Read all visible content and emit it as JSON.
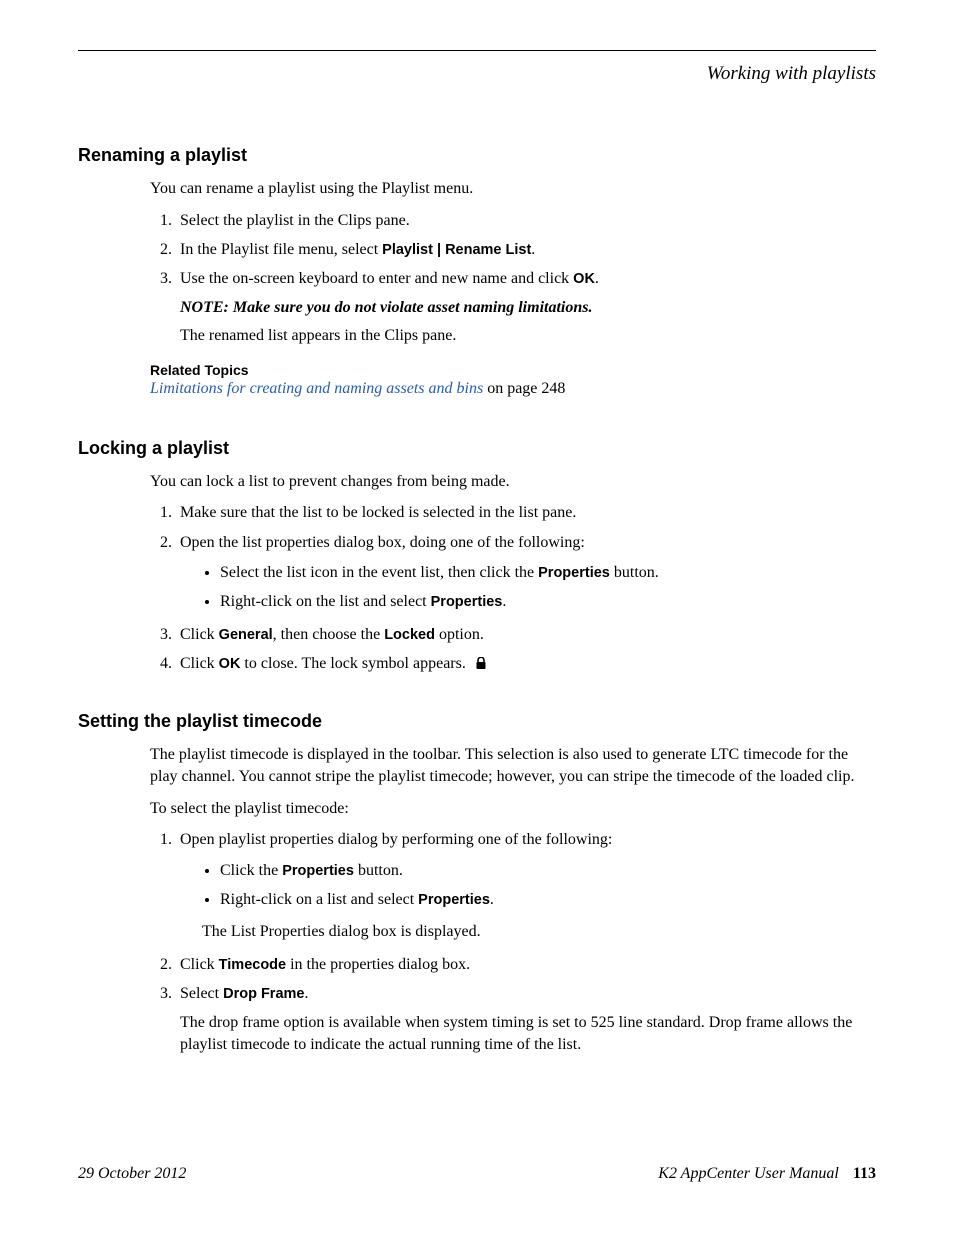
{
  "header": {
    "breadcrumb": "Working with playlists"
  },
  "sections": {
    "rename": {
      "heading": "Renaming a playlist",
      "intro": "You can rename a playlist using the Playlist menu.",
      "step1": "Select the playlist in the Clips pane.",
      "step2_pre": "In the Playlist file menu, select ",
      "step2_menu": "Playlist | Rename List",
      "step2_post": ".",
      "step3_pre": "Use the on-screen keyboard to enter and new name and click ",
      "step3_btn": "OK",
      "step3_post": ".",
      "note": "NOTE:  Make sure you do not violate asset naming limitations.",
      "note_after": "The renamed list appears in the Clips pane.",
      "related_label": "Related Topics",
      "related_link_text": "Limitations for creating and naming assets and bins",
      "related_link_trail": " on page 248"
    },
    "lock": {
      "heading": "Locking a playlist",
      "intro": "You can lock a list to prevent changes from being made.",
      "step1": "Make sure that the list to be locked is selected in the list pane.",
      "step2": "Open the list properties dialog box, doing one of the following:",
      "step2_a_pre": "Select the list icon in the event list, then click the ",
      "step2_a_btn": "Properties",
      "step2_a_post": " button.",
      "step2_b_pre": "Right-click on the list and select ",
      "step2_b_btn": "Properties",
      "step2_b_post": ".",
      "step3_pre": "Click ",
      "step3_btn1": "General",
      "step3_mid": ", then choose the ",
      "step3_btn2": "Locked",
      "step3_post": " option.",
      "step4_pre": "Click ",
      "step4_btn": "OK",
      "step4_post": " to close. The lock symbol appears."
    },
    "timecode": {
      "heading": "Setting the playlist timecode",
      "intro": "The playlist timecode is displayed in the toolbar. This selection is also used to generate LTC timecode for the play channel. You cannot stripe the playlist timecode; however, you can stripe the timecode of the loaded clip.",
      "intro2": "To select the playlist timecode:",
      "step1": "Open playlist properties dialog by performing one of the following:",
      "step1_a_pre": "Click the ",
      "step1_a_btn": "Properties",
      "step1_a_post": " button.",
      "step1_b_pre": "Right-click on a list and select ",
      "step1_b_btn": "Properties",
      "step1_b_post": ".",
      "step1_after": "The List Properties dialog box is displayed.",
      "step2_pre": "Click ",
      "step2_btn": "Timecode",
      "step2_post": " in the properties dialog box.",
      "step3_pre": "Select ",
      "step3_btn": "Drop Frame",
      "step3_post": ".",
      "step3_after": "The drop frame option is available when system timing is set to 525 line standard. Drop frame allows the playlist timecode to indicate the actual running time of the list."
    }
  },
  "footer": {
    "date": "29 October 2012",
    "manual": "K2 AppCenter User Manual",
    "page": "113"
  }
}
